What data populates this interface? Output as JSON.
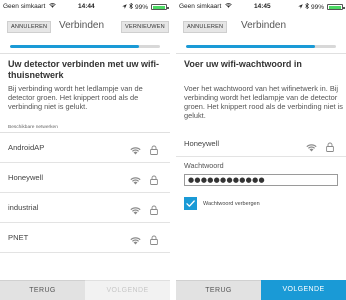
{
  "left_screen": {
    "status": {
      "carrier": "Geen simkaart",
      "time": "14:44",
      "battery": "99%",
      "battery_level": 0.99
    },
    "nav": {
      "cancel_label": "ANNULEREN",
      "title": "Verbinden",
      "refresh_label": "VERNIEUWEN"
    },
    "progress": 0.86,
    "heading": "Uw detector verbinden met uw wifi-thuisnetwerk",
    "description": "Bij verbinding wordt het ledlampje van de detector groen. Het knippert rood als de verbinding niet is gelukt.",
    "networks_label": "Beschikbare netwerken",
    "networks": [
      {
        "name": "AndroidAP"
      },
      {
        "name": "Honeywell"
      },
      {
        "name": "industrial"
      },
      {
        "name": "PNET"
      }
    ],
    "footer": {
      "back_label": "TERUG",
      "next_label": "VOLGENDE"
    }
  },
  "right_screen": {
    "status": {
      "carrier": "Geen simkaart",
      "time": "14:45",
      "battery": "99%",
      "battery_level": 0.99
    },
    "nav": {
      "cancel_label": "ANNULEREN",
      "title": "Verbinden"
    },
    "progress": 0.86,
    "heading": "Voer uw wifi-wachtwoord in",
    "description": "Voer het wachtwoord van het wifinetwerk in. Bij verbinding wordt het ledlampje van de detector groen. Het knippert rood als de verbinding niet is gelukt.",
    "selected_network": "Honeywell",
    "password_label": "Wachtwoord",
    "password_value": "●●●●●●●●●●●●",
    "hide_password_label": "Wachtwoord verbergen",
    "hide_password_checked": true,
    "footer": {
      "back_label": "TERUG",
      "next_label": "VOLGENDE"
    }
  },
  "icons": {
    "status_wifi": "wifi-icon",
    "location": "location-arrow-icon",
    "bluetooth": "bluetooth-icon",
    "battery": "battery-icon",
    "network_signal": "wifi-icon",
    "network_lock": "lock-icon",
    "checkbox": "checkmark-icon"
  },
  "colors": {
    "accent": "#1a9ad6",
    "battery_fill": "#4cd964",
    "disabled_button_bg": "#f2f2f2",
    "back_button_bg": "#e2e2e2"
  }
}
